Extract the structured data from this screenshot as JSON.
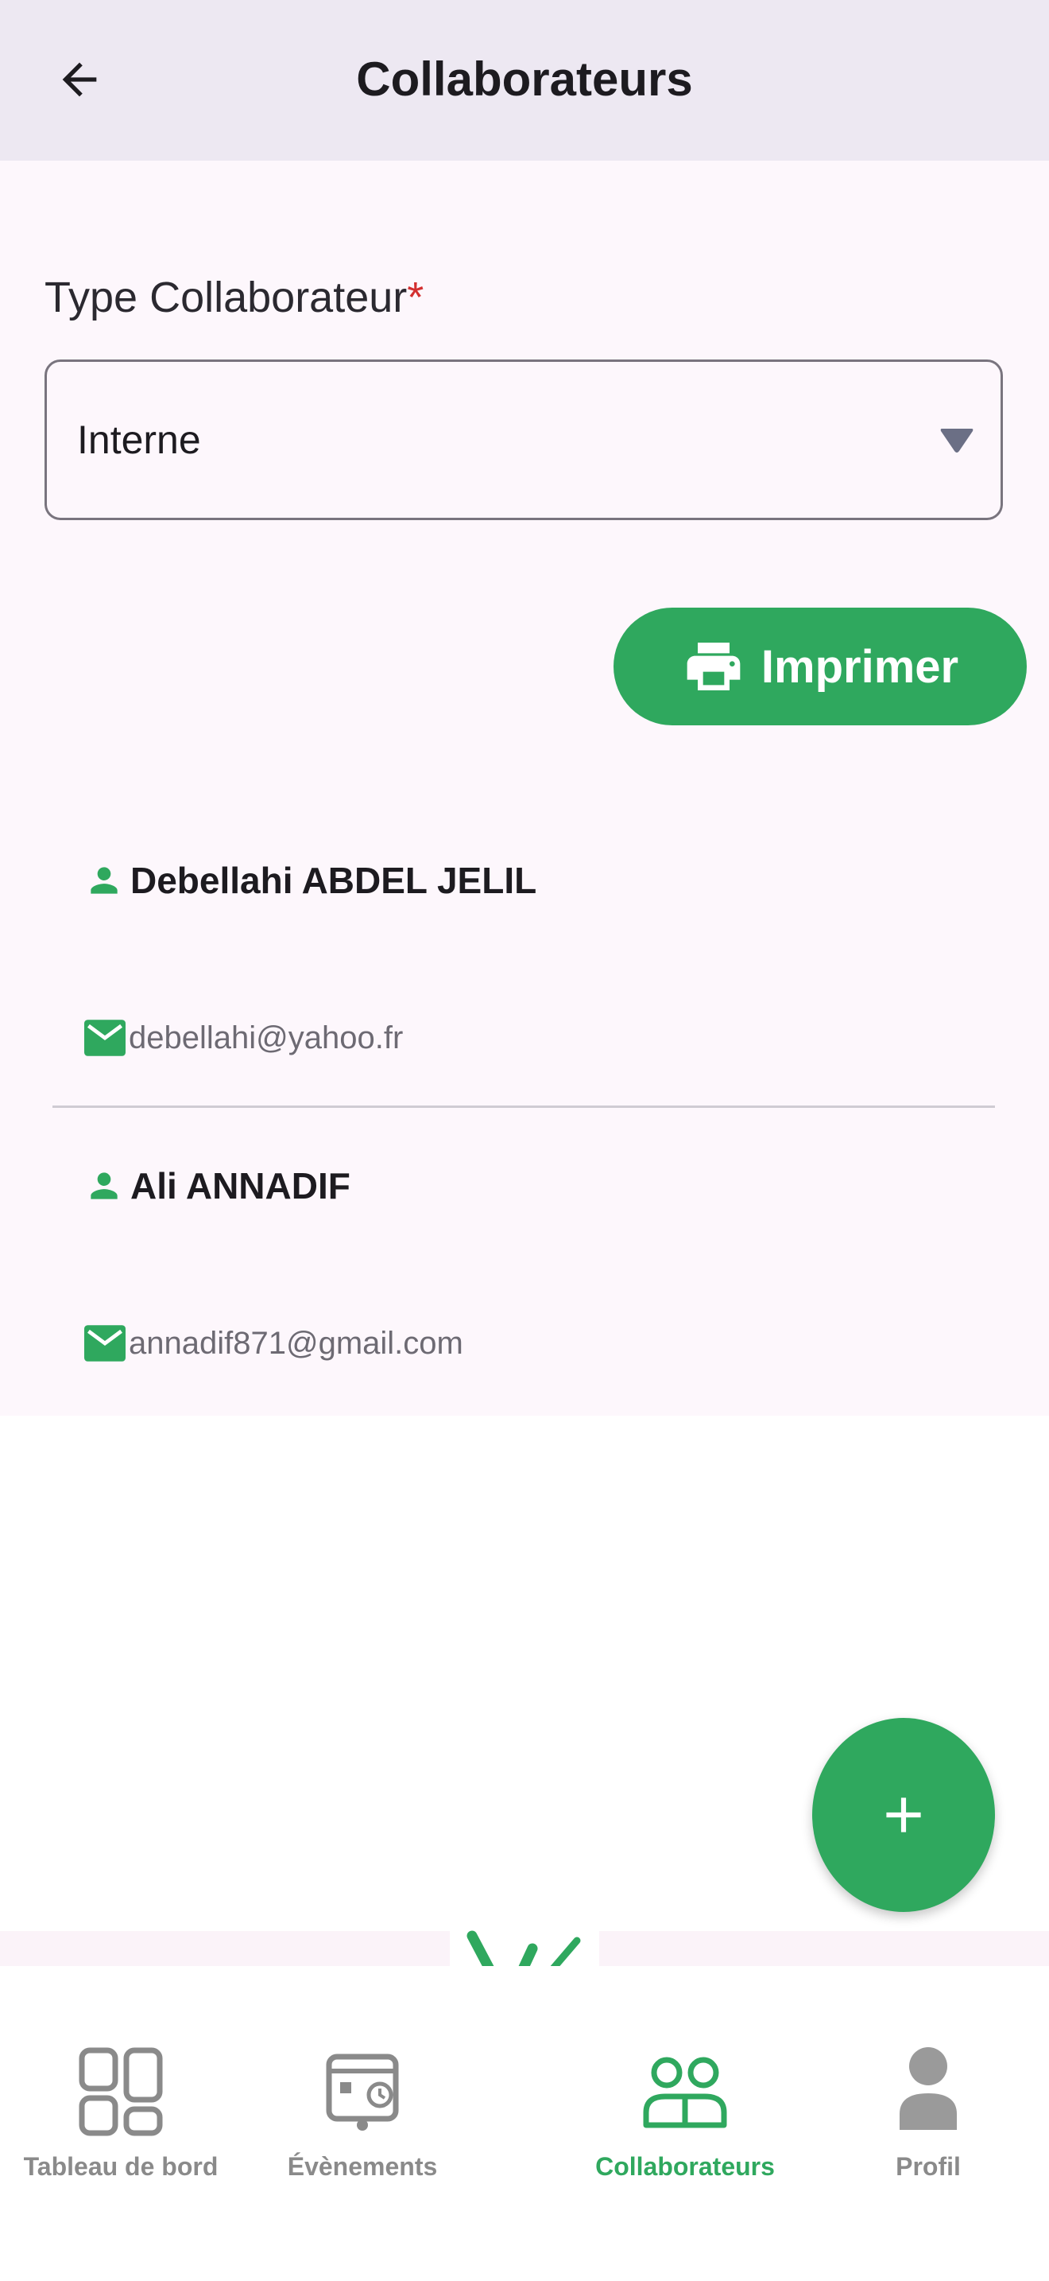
{
  "header": {
    "title": "Collaborateurs"
  },
  "form": {
    "type_label": "Type Collaborateur",
    "required_mark": "*",
    "type_value": "Interne"
  },
  "actions": {
    "print_label": "Imprimer"
  },
  "collaborators": [
    {
      "name": "Debellahi ABDEL JELIL",
      "email": "debellahi@yahoo.fr"
    },
    {
      "name": "Ali ANNADIF",
      "email": "annadif871@gmail.com"
    }
  ],
  "bottom_nav": {
    "items": [
      {
        "label": "Tableau de bord",
        "icon": "dashboard-icon",
        "active": false
      },
      {
        "label": "Évènements",
        "icon": "events-icon",
        "active": false
      },
      {
        "label": "Collaborateurs",
        "icon": "collaborators-icon",
        "active": true
      },
      {
        "label": "Profil",
        "icon": "profile-icon",
        "active": false
      }
    ]
  },
  "colors": {
    "accent": "#2fa85e",
    "header_bg": "#ede8f2",
    "content_bg": "#fdf7fc",
    "inactive": "#8a8a8a"
  }
}
